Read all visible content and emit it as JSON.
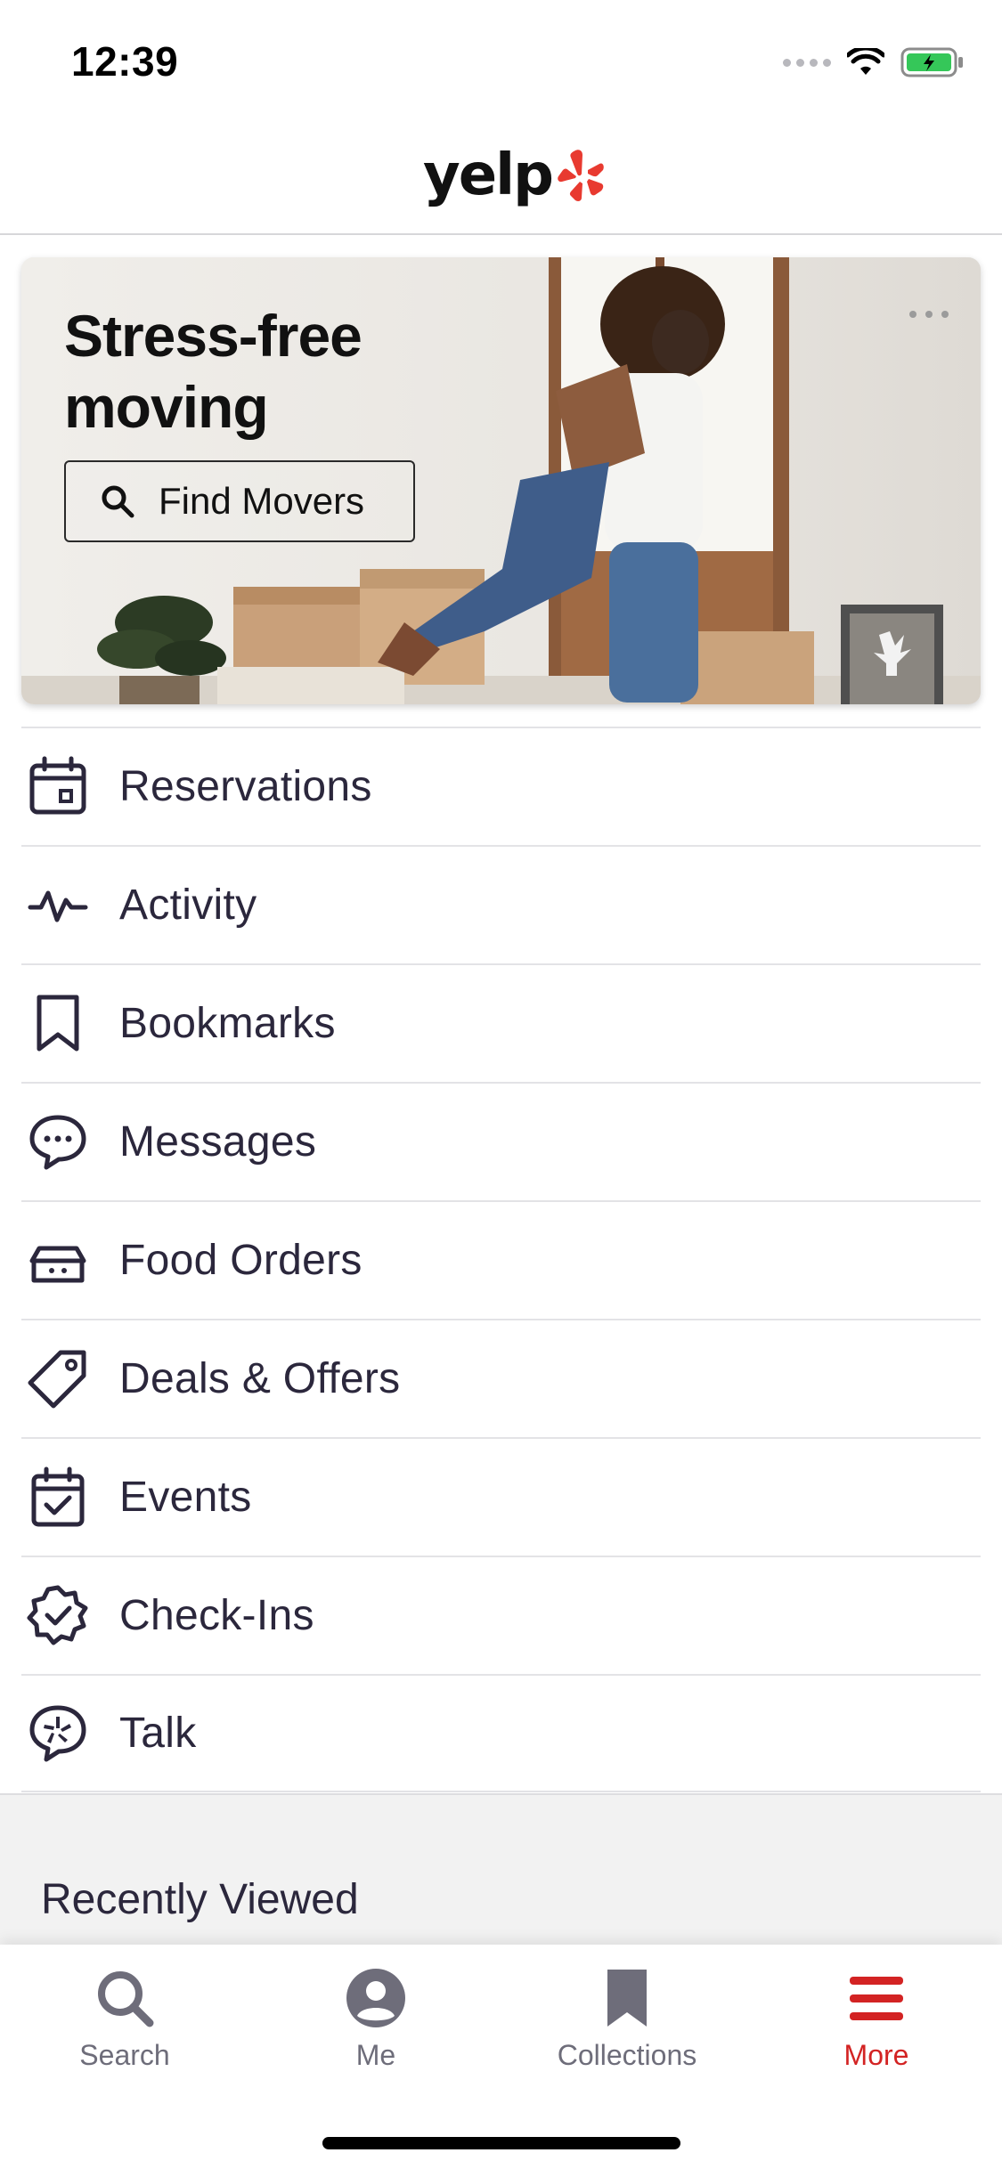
{
  "status_bar": {
    "time": "12:39"
  },
  "header": {
    "logo_text": "yelp"
  },
  "hero": {
    "title_line1": "Stress-free",
    "title_line2": "moving",
    "button_label": "Find Movers"
  },
  "menu": {
    "items": [
      {
        "label": "Reservations",
        "icon": "calendar-icon"
      },
      {
        "label": "Activity",
        "icon": "activity-pulse-icon"
      },
      {
        "label": "Bookmarks",
        "icon": "bookmark-icon"
      },
      {
        "label": "Messages",
        "icon": "chat-bubble-icon"
      },
      {
        "label": "Food Orders",
        "icon": "food-basket-icon"
      },
      {
        "label": "Deals & Offers",
        "icon": "tag-icon"
      },
      {
        "label": "Events",
        "icon": "calendar-check-icon"
      },
      {
        "label": "Check-Ins",
        "icon": "badge-check-icon"
      },
      {
        "label": "Talk",
        "icon": "talk-bubble-icon"
      }
    ]
  },
  "recently_viewed": {
    "title": "Recently Viewed"
  },
  "tabbar": {
    "tabs": [
      {
        "label": "Search",
        "icon": "search-icon"
      },
      {
        "label": "Me",
        "icon": "user-icon"
      },
      {
        "label": "Collections",
        "icon": "bookmark-icon"
      },
      {
        "label": "More",
        "icon": "menu-icon",
        "active": true
      }
    ]
  },
  "colors": {
    "brand_red": "#d32323",
    "text_dark": "#2b273c",
    "text_muted": "#6e6d7a"
  }
}
